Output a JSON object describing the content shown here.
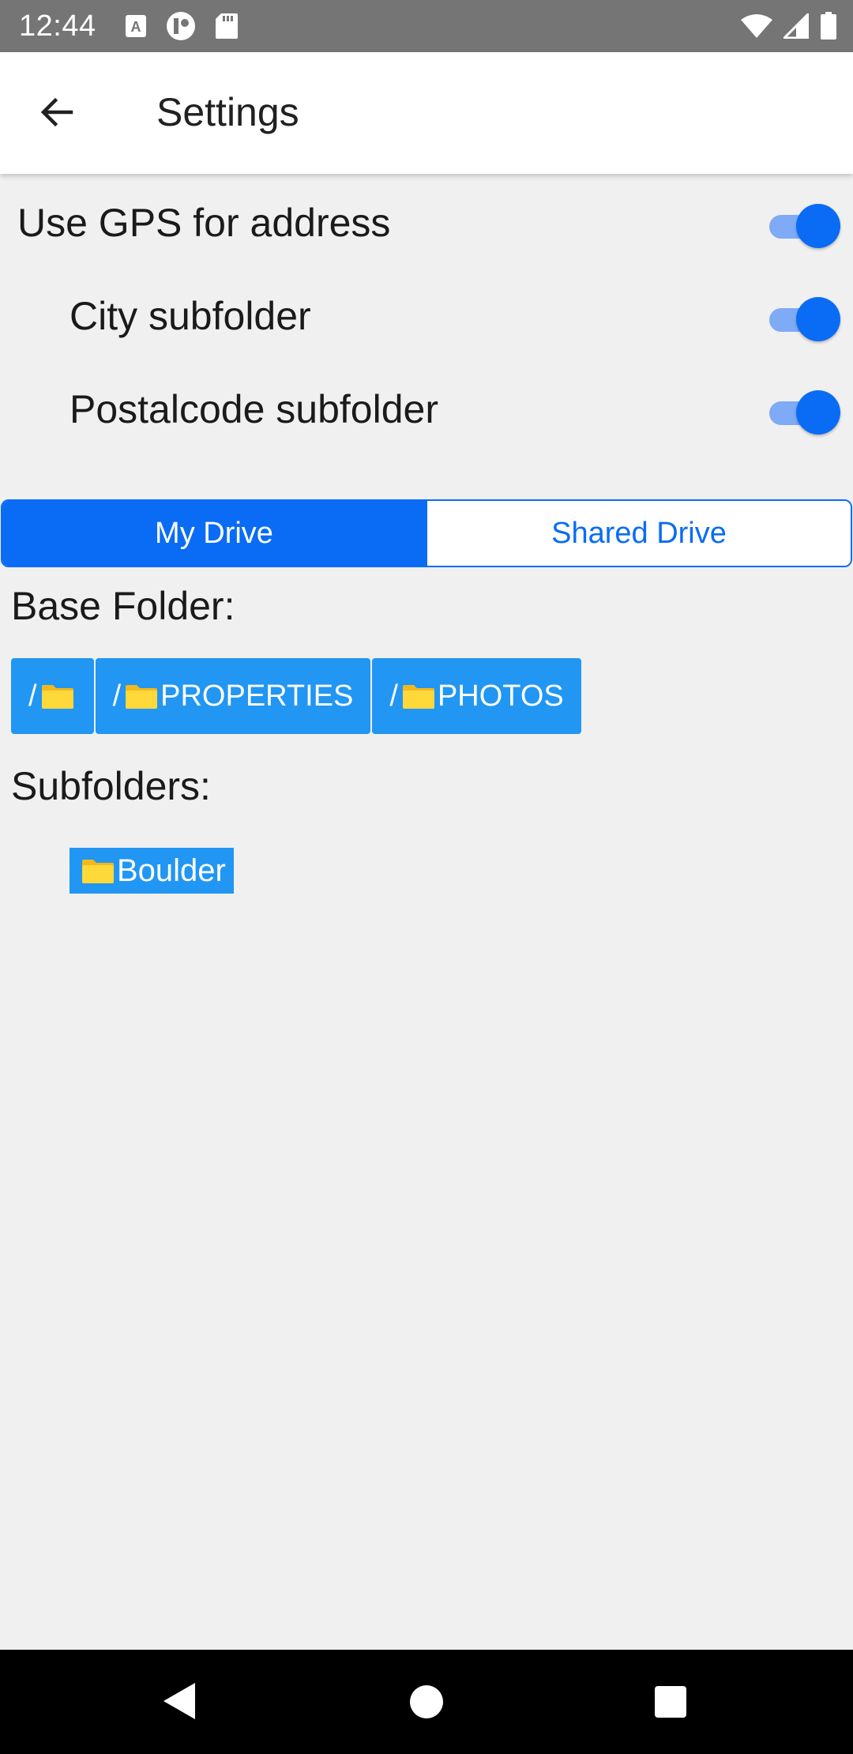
{
  "status_bar": {
    "time": "12:44",
    "icons": [
      "text-a-icon",
      "circle-app-icon",
      "sd-card-icon",
      "wifi-icon",
      "signal-icon",
      "battery-icon"
    ]
  },
  "app_bar": {
    "title": "Settings",
    "back_icon": "arrow-left-icon"
  },
  "settings": {
    "gps": {
      "label": "Use GPS for address",
      "on": true
    },
    "city": {
      "label": "City subfolder",
      "on": true
    },
    "postal": {
      "label": "Postalcode subfolder",
      "on": true
    }
  },
  "drive_tabs": {
    "my_drive": "My Drive",
    "shared_drive": "Shared Drive",
    "selected": "My Drive"
  },
  "base_folder": {
    "label": "Base Folder:",
    "crumbs": [
      {
        "slash": "/",
        "name": ""
      },
      {
        "slash": "/",
        "name": "PROPERTIES"
      },
      {
        "slash": "/",
        "name": "PHOTOS"
      }
    ]
  },
  "subfolders": {
    "label": "Subfolders:",
    "items": [
      "Boulder"
    ]
  },
  "colors": {
    "accent": "#0a6cf5",
    "chip": "#2196f3",
    "background": "#f0f0f0",
    "status_bar": "#757575"
  }
}
